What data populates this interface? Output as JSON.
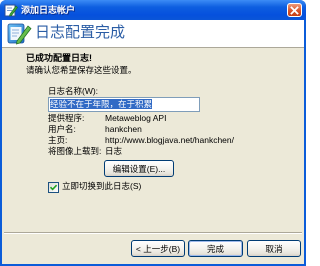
{
  "window": {
    "title": "添加日志帐户"
  },
  "header": {
    "title": "日志配置完成"
  },
  "body": {
    "success_heading": "已成功配置日志!",
    "confirm_text": "请确认您希望保存这些设置。",
    "blog_name_label": "日志名称(W):",
    "blog_name_value": "经验不在于年限，在于积累",
    "details": [
      {
        "label": "提供程序:",
        "value": "Metaweblog API"
      },
      {
        "label": "用户名:",
        "value": "hankchen"
      },
      {
        "label": "主页:",
        "value": "http://www.blogjava.net/hankchen/"
      },
      {
        "label": "将图像上载到:",
        "value": "日志"
      }
    ],
    "edit_settings_label": "编辑设置(E)...",
    "switch_checkbox": {
      "label": "立即切换到此日志(S)",
      "checked": true
    }
  },
  "footer": {
    "back_label": "< 上一步(B)",
    "finish_label": "完成",
    "cancel_label": "取消"
  },
  "icons": {
    "title": "writer-icon",
    "logo": "writer-logo-icon",
    "close": "close-icon",
    "check": "checkmark-icon"
  },
  "colors": {
    "title_bar_top": "#3C8CF5",
    "title_bar": "#0E5FE0",
    "header_title": "#2B5DA5",
    "dialog_bg": "#ECE9D8",
    "selection": "#316AC5"
  }
}
